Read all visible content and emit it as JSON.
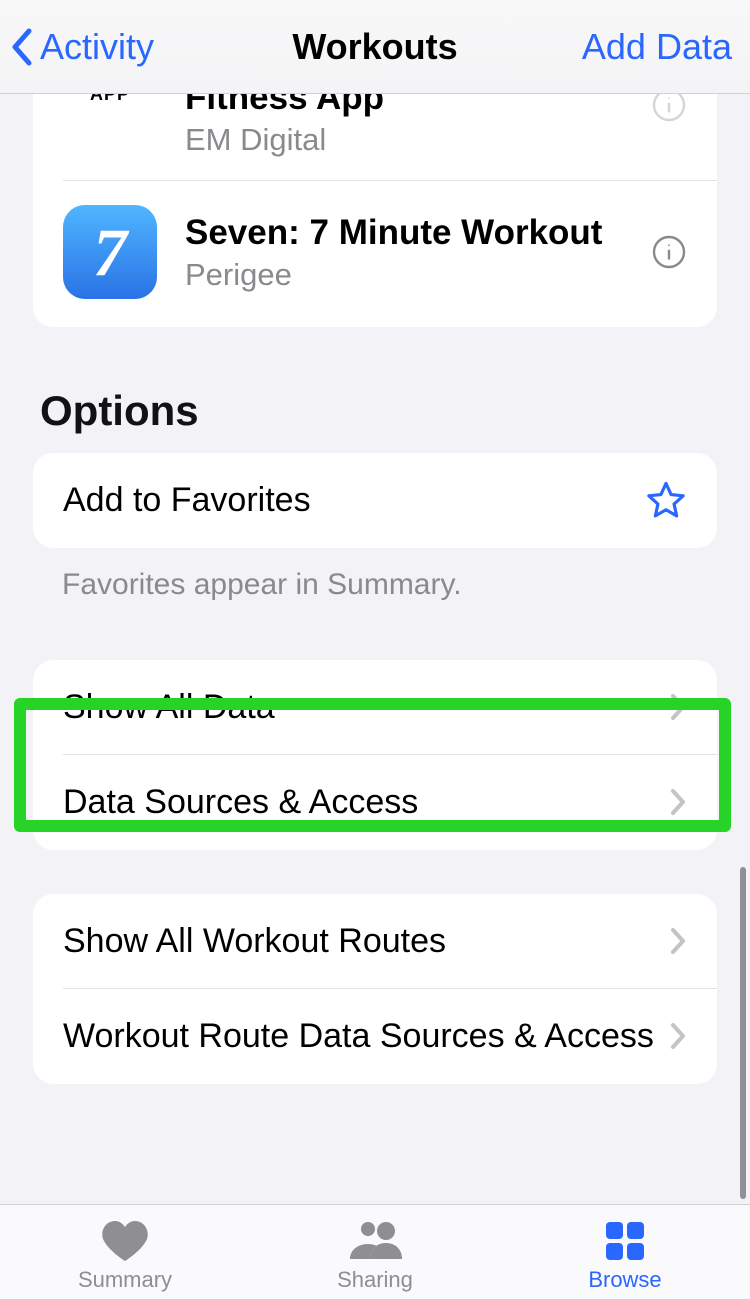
{
  "nav": {
    "back_label": "Activity",
    "title": "Workouts",
    "action_label": "Add Data"
  },
  "apps": [
    {
      "icon_text": "APP",
      "title": "Fitness App",
      "subtitle": "EM Digital"
    },
    {
      "icon_text": "7",
      "title": "Seven: 7 Minute Workout",
      "subtitle": "Perigee"
    }
  ],
  "options_header": "Options",
  "favorites": {
    "label": "Add to Favorites",
    "footnote": "Favorites appear in Summary."
  },
  "data_rows": {
    "show_all_data": "Show All Data",
    "data_sources": "Data Sources & Access",
    "show_routes": "Show All Workout Routes",
    "route_sources": "Workout Route Data Sources & Access"
  },
  "tabs": {
    "summary": "Summary",
    "sharing": "Sharing",
    "browse": "Browse"
  },
  "highlight_target": "show_all_data"
}
